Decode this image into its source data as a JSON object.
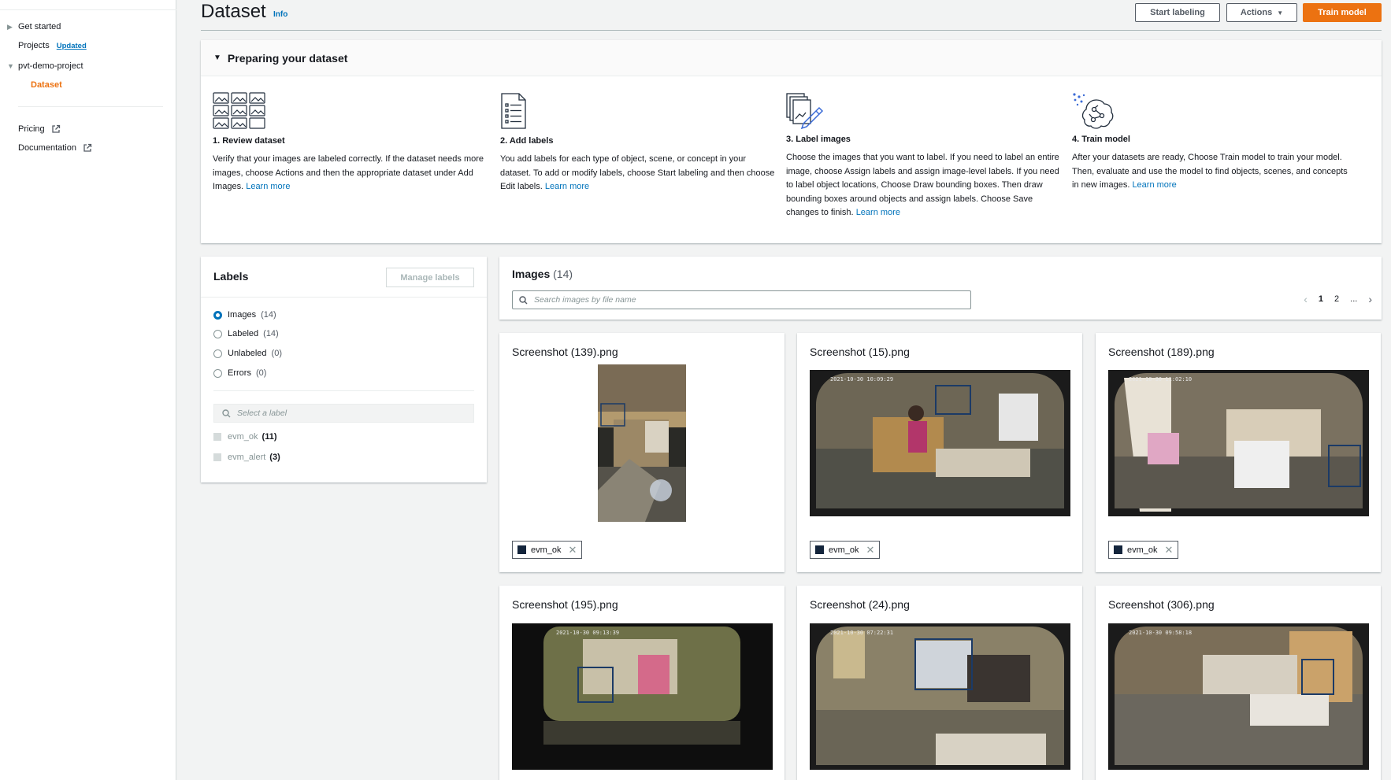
{
  "sidebar": {
    "items": [
      {
        "label": "Get started"
      },
      {
        "label": "Projects",
        "badge": "Updated"
      },
      {
        "label": "pvt-demo-project"
      },
      {
        "label": "Dataset"
      }
    ],
    "links": [
      {
        "label": "Pricing"
      },
      {
        "label": "Documentation"
      }
    ]
  },
  "header": {
    "title": "Dataset",
    "info": "Info",
    "start_labeling": "Start labeling",
    "actions": "Actions",
    "train_model": "Train model"
  },
  "prep": {
    "title": "Preparing your dataset",
    "steps": [
      {
        "title": "1. Review dataset",
        "text": "Verify that your images are labeled correctly. If the dataset needs more images, choose Actions and then the appropriate dataset under Add Images.",
        "link": "Learn more"
      },
      {
        "title": "2. Add labels",
        "text": "You add labels for each type of object, scene, or concept in your dataset. To add or modify labels, choose Start labeling and then choose Edit labels.",
        "link": "Learn more"
      },
      {
        "title": "3. Label images",
        "text": "Choose the images that you want to label. If you need to label an entire image, choose Assign labels and assign image-level labels. If you need to label object locations, Choose Draw bounding boxes. Then draw bounding boxes around objects and assign labels. Choose Save changes to finish.",
        "link": "Learn more"
      },
      {
        "title": "4. Train model",
        "text": "After your datasets are ready, Choose Train model to train your model. Then, evaluate and use the model to find objects, scenes, and concepts in new images.",
        "link": "Learn more"
      }
    ]
  },
  "labels_panel": {
    "title": "Labels",
    "manage": "Manage labels",
    "filters": [
      {
        "label": "Images",
        "count": "(14)",
        "selected": true
      },
      {
        "label": "Labeled",
        "count": "(14)",
        "selected": false
      },
      {
        "label": "Unlabeled",
        "count": "(0)",
        "selected": false
      },
      {
        "label": "Errors",
        "count": "(0)",
        "selected": false
      }
    ],
    "search_placeholder": "Select a label",
    "label_list": [
      {
        "name": "evm_ok",
        "count": "(11)"
      },
      {
        "name": "evm_alert",
        "count": "(3)"
      }
    ]
  },
  "images_panel": {
    "title": "Images",
    "count": "(14)",
    "search_placeholder": "Search images by file name",
    "pages": [
      "1",
      "2",
      "..."
    ]
  },
  "cards": [
    {
      "filename": "Screenshot (139).png",
      "tag": "evm_ok"
    },
    {
      "filename": "Screenshot (15).png",
      "tag": "evm_ok"
    },
    {
      "filename": "Screenshot (189).png",
      "tag": "evm_ok"
    },
    {
      "filename": "Screenshot (195).png"
    },
    {
      "filename": "Screenshot (24).png"
    },
    {
      "filename": "Screenshot (306).png"
    }
  ],
  "thumb_timestamps": [
    "2021-10-30 10:09:29",
    "2021-10-30 11:02:10",
    "2021-10-30 09:13:39",
    "2021-10-30 07:22:31",
    "2021-10-30 09:58:18"
  ],
  "colors": {
    "accent": "#ec7211",
    "link": "#0073bb",
    "label_swatch": "#14253c"
  }
}
